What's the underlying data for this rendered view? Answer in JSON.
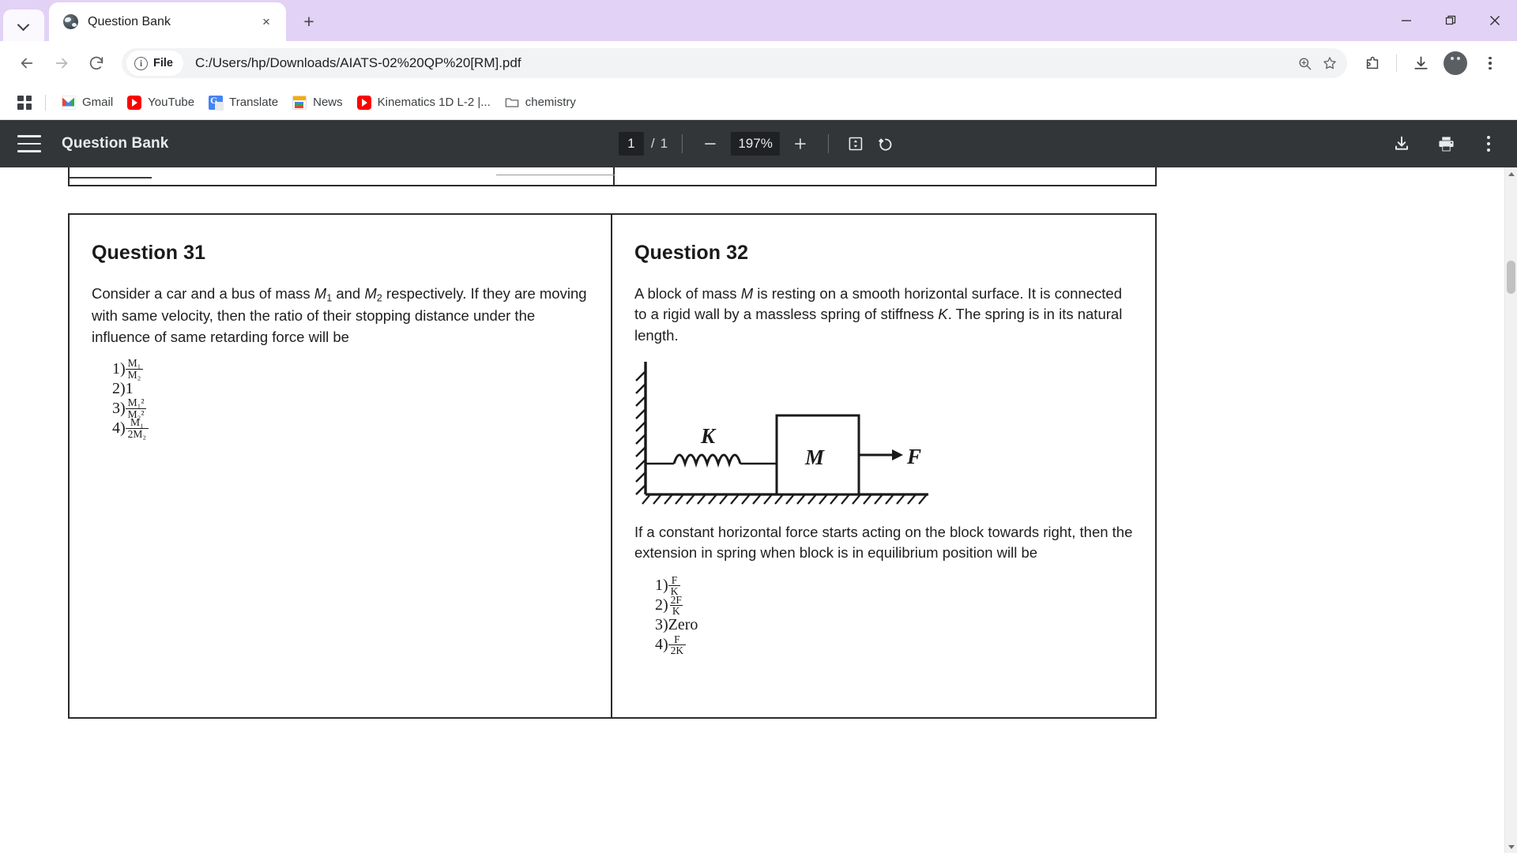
{
  "window": {
    "minimize_label": "Minimize",
    "maximize_label": "Restore",
    "close_label": "Close"
  },
  "tabstrip": {
    "tab_search_label": "Search tabs",
    "tabs": [
      {
        "title": "Question Bank",
        "favicon": "globe-icon",
        "close_label": "×"
      }
    ],
    "new_tab_label": "+"
  },
  "toolbar": {
    "back_label": "Back",
    "forward_label": "Forward",
    "reload_label": "Reload",
    "file_chip_label": "File",
    "url": "C:/Users/hp/Downloads/AIATS-02%20QP%20[RM].pdf",
    "zoom_icon": "zoom-in-icon",
    "bookmark_icon": "star-icon",
    "extensions_icon": "extensions-icon",
    "download_icon": "download-icon",
    "profile_icon": "avatar",
    "menu_icon": "kebab-menu-icon"
  },
  "bookmarks": {
    "apps_label": "All apps",
    "items": [
      {
        "label": "Gmail",
        "icon": "gmail-icon"
      },
      {
        "label": "YouTube",
        "icon": "youtube-icon"
      },
      {
        "label": "Translate",
        "icon": "google-translate-icon"
      },
      {
        "label": "News",
        "icon": "google-news-icon"
      },
      {
        "label": "Kinematics 1D L-2 |...",
        "icon": "youtube-icon"
      },
      {
        "label": "chemistry",
        "icon": "folder-icon"
      }
    ]
  },
  "pdf_toolbar": {
    "menu_label": "Menu",
    "title": "Question Bank",
    "page_current": "1",
    "page_separator": "/",
    "page_total": "1",
    "zoom_out_label": "—",
    "zoom_value": "197%",
    "zoom_in_label": "+",
    "fit_page_label": "Fit to page",
    "rotate_label": "Rotate counterclockwise",
    "download_label": "Download",
    "print_label": "Print",
    "more_label": "More actions"
  },
  "document": {
    "questions": [
      {
        "title": "Question 31",
        "body_parts": [
          {
            "t": "text",
            "v": "Consider a car and a bus of mass "
          },
          {
            "t": "italic",
            "v": "M"
          },
          {
            "t": "sub",
            "v": "1"
          },
          {
            "t": "text",
            "v": " and "
          },
          {
            "t": "italic",
            "v": "M"
          },
          {
            "t": "sub",
            "v": "2"
          },
          {
            "t": "text",
            "v": " respectively. If they are moving with same velocity, then the ratio of their stopping distance under the influence of same retarding force will be"
          }
        ],
        "body_plain": "Consider a car and a bus of mass M1 and M2 respectively. If they are moving with same velocity, then the ratio of their stopping distance under the influence of same retarding force will be",
        "options": [
          {
            "num": "1)",
            "kind": "fraction",
            "numerator": "M₁",
            "denominator": "M₂"
          },
          {
            "num": "2)",
            "kind": "plain",
            "text": "1"
          },
          {
            "num": "3)",
            "kind": "fraction",
            "numerator": "M₁²",
            "denominator": "M₂²"
          },
          {
            "num": "4)",
            "kind": "fraction",
            "numerator": "M₁",
            "denominator": "2M₂"
          }
        ]
      },
      {
        "title": "Question 32",
        "body_plain": "A block of mass M is resting on a smooth horizontal surface. It is connected to a rigid wall by a massless spring of stiffness K. The spring is in its natural length.",
        "diagram": {
          "name": "spring-block-diagram",
          "spring_label": "K",
          "block_label": "M",
          "force_label": "F",
          "wall": "hatched-wall",
          "ground": "hatched-ground"
        },
        "body_after": "If a constant horizontal force starts acting on the block towards right, then the extension in spring when block is in equilibrium position will be",
        "options": [
          {
            "num": "1)",
            "kind": "fraction",
            "numerator": "F",
            "denominator": "K"
          },
          {
            "num": "2)",
            "kind": "fraction",
            "numerator": "2F",
            "denominator": "K"
          },
          {
            "num": "3)",
            "kind": "plain",
            "text": "Zero"
          },
          {
            "num": "4)",
            "kind": "fraction",
            "numerator": "F",
            "denominator": "2K"
          }
        ]
      }
    ]
  },
  "scrollbar": {
    "up_label": "Scroll up",
    "down_label": "Scroll down",
    "thumb_label": "Scroll thumb"
  },
  "colors": {
    "tabstrip_bg": "#e2d2f5",
    "pdf_toolbar_bg": "#323639",
    "accent": "#1a73e8"
  }
}
